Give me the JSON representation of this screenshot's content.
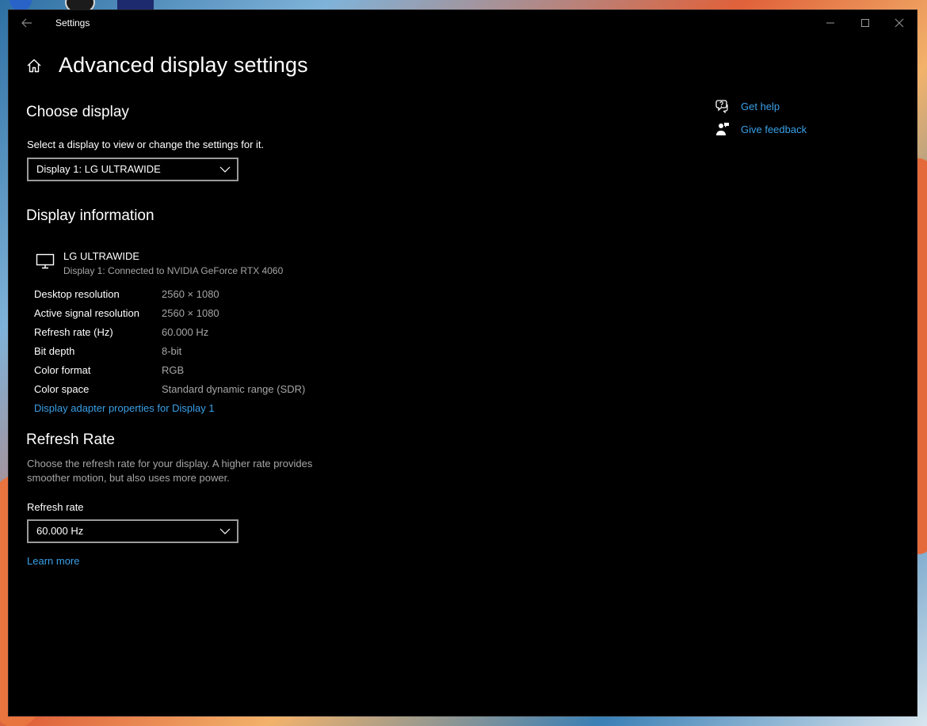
{
  "window": {
    "title": "Settings"
  },
  "page": {
    "title": "Advanced display settings"
  },
  "choose_display": {
    "heading": "Choose display",
    "instruction": "Select a display to view or change the settings for it.",
    "selected_display": "Display 1: LG ULTRAWIDE"
  },
  "display_information": {
    "heading": "Display information",
    "monitor_name": "LG ULTRAWIDE",
    "connection": "Display 1: Connected to NVIDIA GeForce RTX 4060",
    "rows": [
      {
        "label": "Desktop resolution",
        "value": "2560 × 1080"
      },
      {
        "label": "Active signal resolution",
        "value": "2560 × 1080"
      },
      {
        "label": "Refresh rate (Hz)",
        "value": "60.000 Hz"
      },
      {
        "label": "Bit depth",
        "value": "8-bit"
      },
      {
        "label": "Color format",
        "value": "RGB"
      },
      {
        "label": "Color space",
        "value": "Standard dynamic range (SDR)"
      }
    ],
    "adapter_link": "Display adapter properties for Display 1"
  },
  "refresh_rate": {
    "heading": "Refresh Rate",
    "description": "Choose the refresh rate for your display. A higher rate provides smoother motion, but also uses more power.",
    "field_label": "Refresh rate",
    "selected_rate": "60.000 Hz",
    "learn_more": "Learn more"
  },
  "side_links": {
    "get_help": "Get help",
    "give_feedback": "Give feedback"
  },
  "colors": {
    "background": "#000000",
    "link": "#3aa0e8",
    "secondary_text": "#a6a6a6",
    "dropdown_border": "#9a9a9a"
  },
  "icons": [
    "back-arrow-icon",
    "minimize-icon",
    "maximize-icon",
    "close-icon",
    "home-icon",
    "chevron-down-icon",
    "monitor-icon",
    "help-icon",
    "feedback-icon"
  ]
}
